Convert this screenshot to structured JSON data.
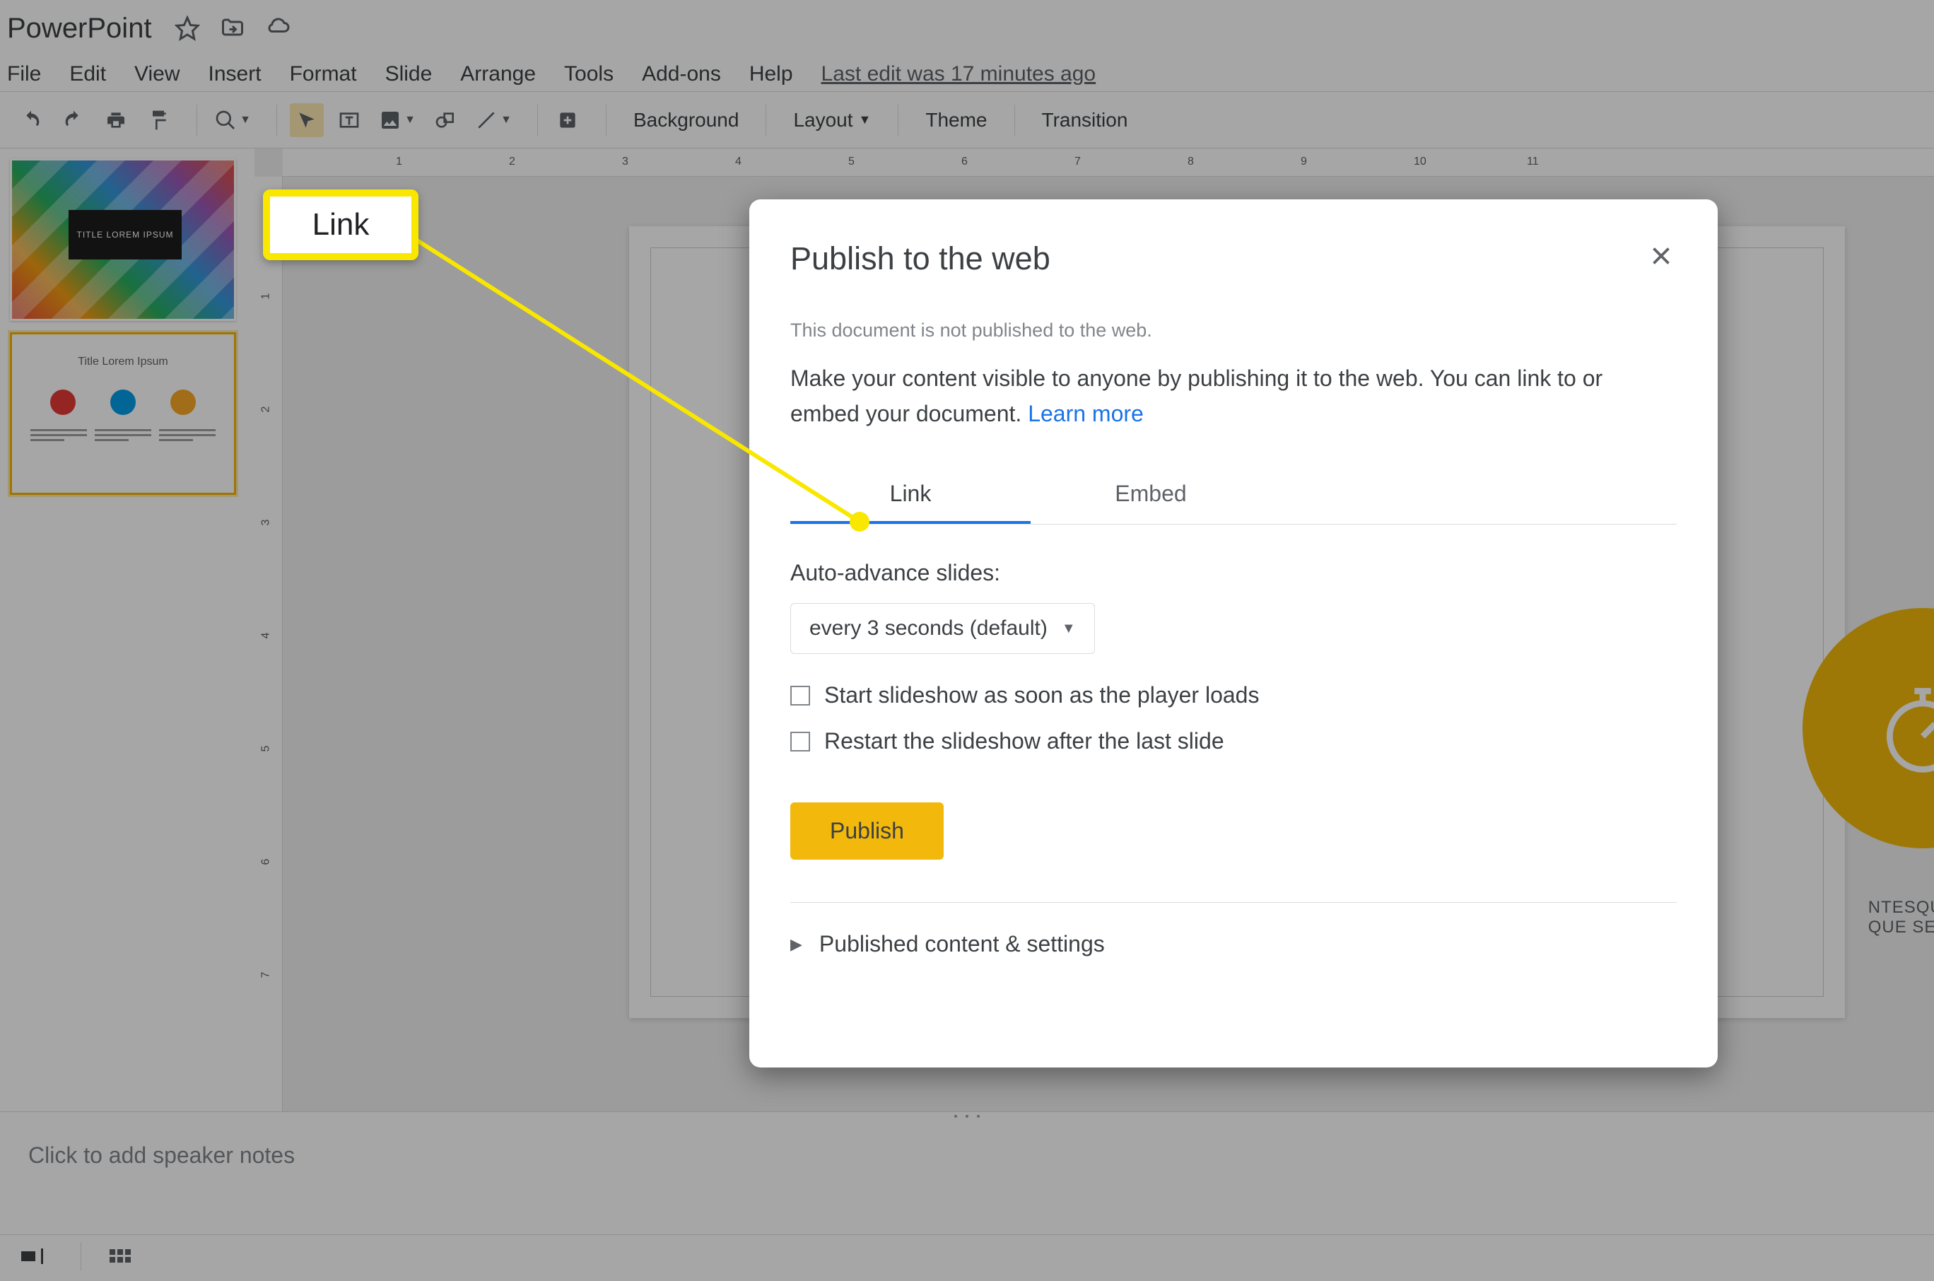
{
  "title": "PowerPoint",
  "menu": {
    "file": "File",
    "edit": "Edit",
    "view": "View",
    "insert": "Insert",
    "format": "Format",
    "slide": "Slide",
    "arrange": "Arrange",
    "tools": "Tools",
    "addons": "Add-ons",
    "help": "Help",
    "lastedit": "Last edit was 17 minutes ago"
  },
  "toolbar_text": {
    "background": "Background",
    "layout": "Layout",
    "theme": "Theme",
    "transition": "Transition"
  },
  "thumb1_title": "TITLE LOREM IPSUM",
  "thumb2_title": "Title Lorem Ipsum",
  "slide_text_line1": "NTESQUE HABITANT",
  "slide_text_line2": "QUE SENECTUS ET N",
  "notes_placeholder": "Click to add speaker notes",
  "ruler_h": [
    "1",
    "2",
    "3",
    "4",
    "5",
    "6",
    "7",
    "8",
    "9",
    "10",
    "11"
  ],
  "ruler_v": [
    "1",
    "2",
    "3",
    "4",
    "5",
    "6",
    "7"
  ],
  "dialog": {
    "title": "Publish to the web",
    "sub1": "This document is not published to the web.",
    "sub2a": "Make your content visible to anyone by publishing it to the web. You can link to or embed your document. ",
    "learn_more": "Learn more",
    "tab_link": "Link",
    "tab_embed": "Embed",
    "auto_advance_label": "Auto-advance slides:",
    "auto_advance_value": "every 3 seconds (default)",
    "check1": "Start slideshow as soon as the player loads",
    "check2": "Restart the slideshow after the last slide",
    "publish": "Publish",
    "expand": "Published content & settings"
  },
  "callout": "Link"
}
